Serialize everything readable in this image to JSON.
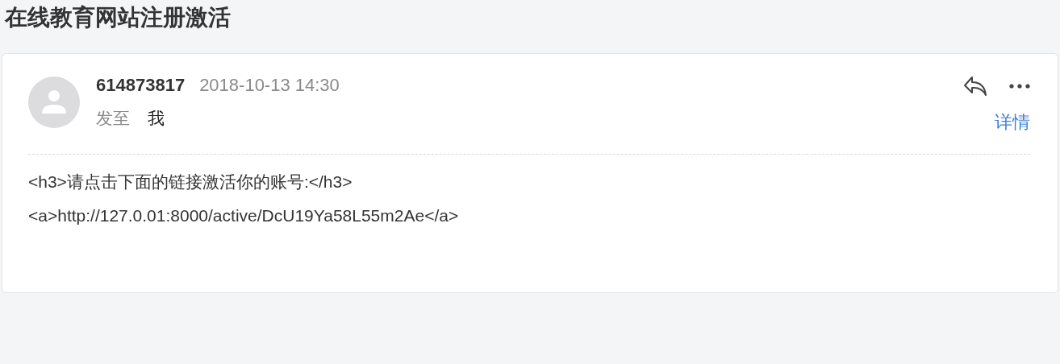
{
  "subject": "在线教育网站注册激活",
  "message": {
    "sender": "614873817",
    "date": "2018-10-13 14:30",
    "to_label": "发至",
    "recipient": "我",
    "details_link": "详情",
    "body": [
      "<h3>请点击下面的链接激活你的账号:</h3>",
      "<a>http://127.0.01:8000/active/DcU19Ya58L55m2Ae</a>"
    ]
  }
}
